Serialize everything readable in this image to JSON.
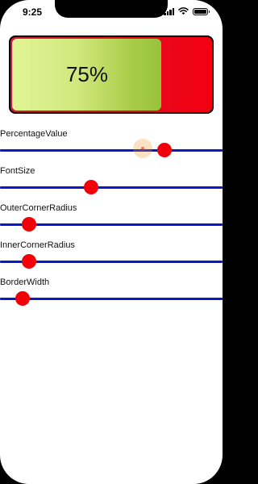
{
  "status_bar": {
    "time": "9:25",
    "icons": [
      "signal-icon",
      "wifi-icon",
      "battery-icon"
    ]
  },
  "battery_view": {
    "label": "75%",
    "fill_fraction": 0.75,
    "colors": {
      "fill_start": "#e2f596",
      "fill_end": "#98c23c",
      "empty_start": "#cc1a3a",
      "empty_end": "#f20010",
      "border": "#000000"
    }
  },
  "sliders": [
    {
      "label": "PercentageValue",
      "value_fraction": 0.74,
      "active": true,
      "ripple_fraction": 0.64
    },
    {
      "label": "FontSize",
      "value_fraction": 0.41
    },
    {
      "label": "OuterCornerRadius",
      "value_fraction": 0.13
    },
    {
      "label": "InnerCornerRadius",
      "value_fraction": 0.13
    },
    {
      "label": "BorderWidth",
      "value_fraction": 0.1
    }
  ],
  "colors": {
    "track": "#0a18c8",
    "thumb": "#f20007",
    "background": "#ffffff"
  }
}
